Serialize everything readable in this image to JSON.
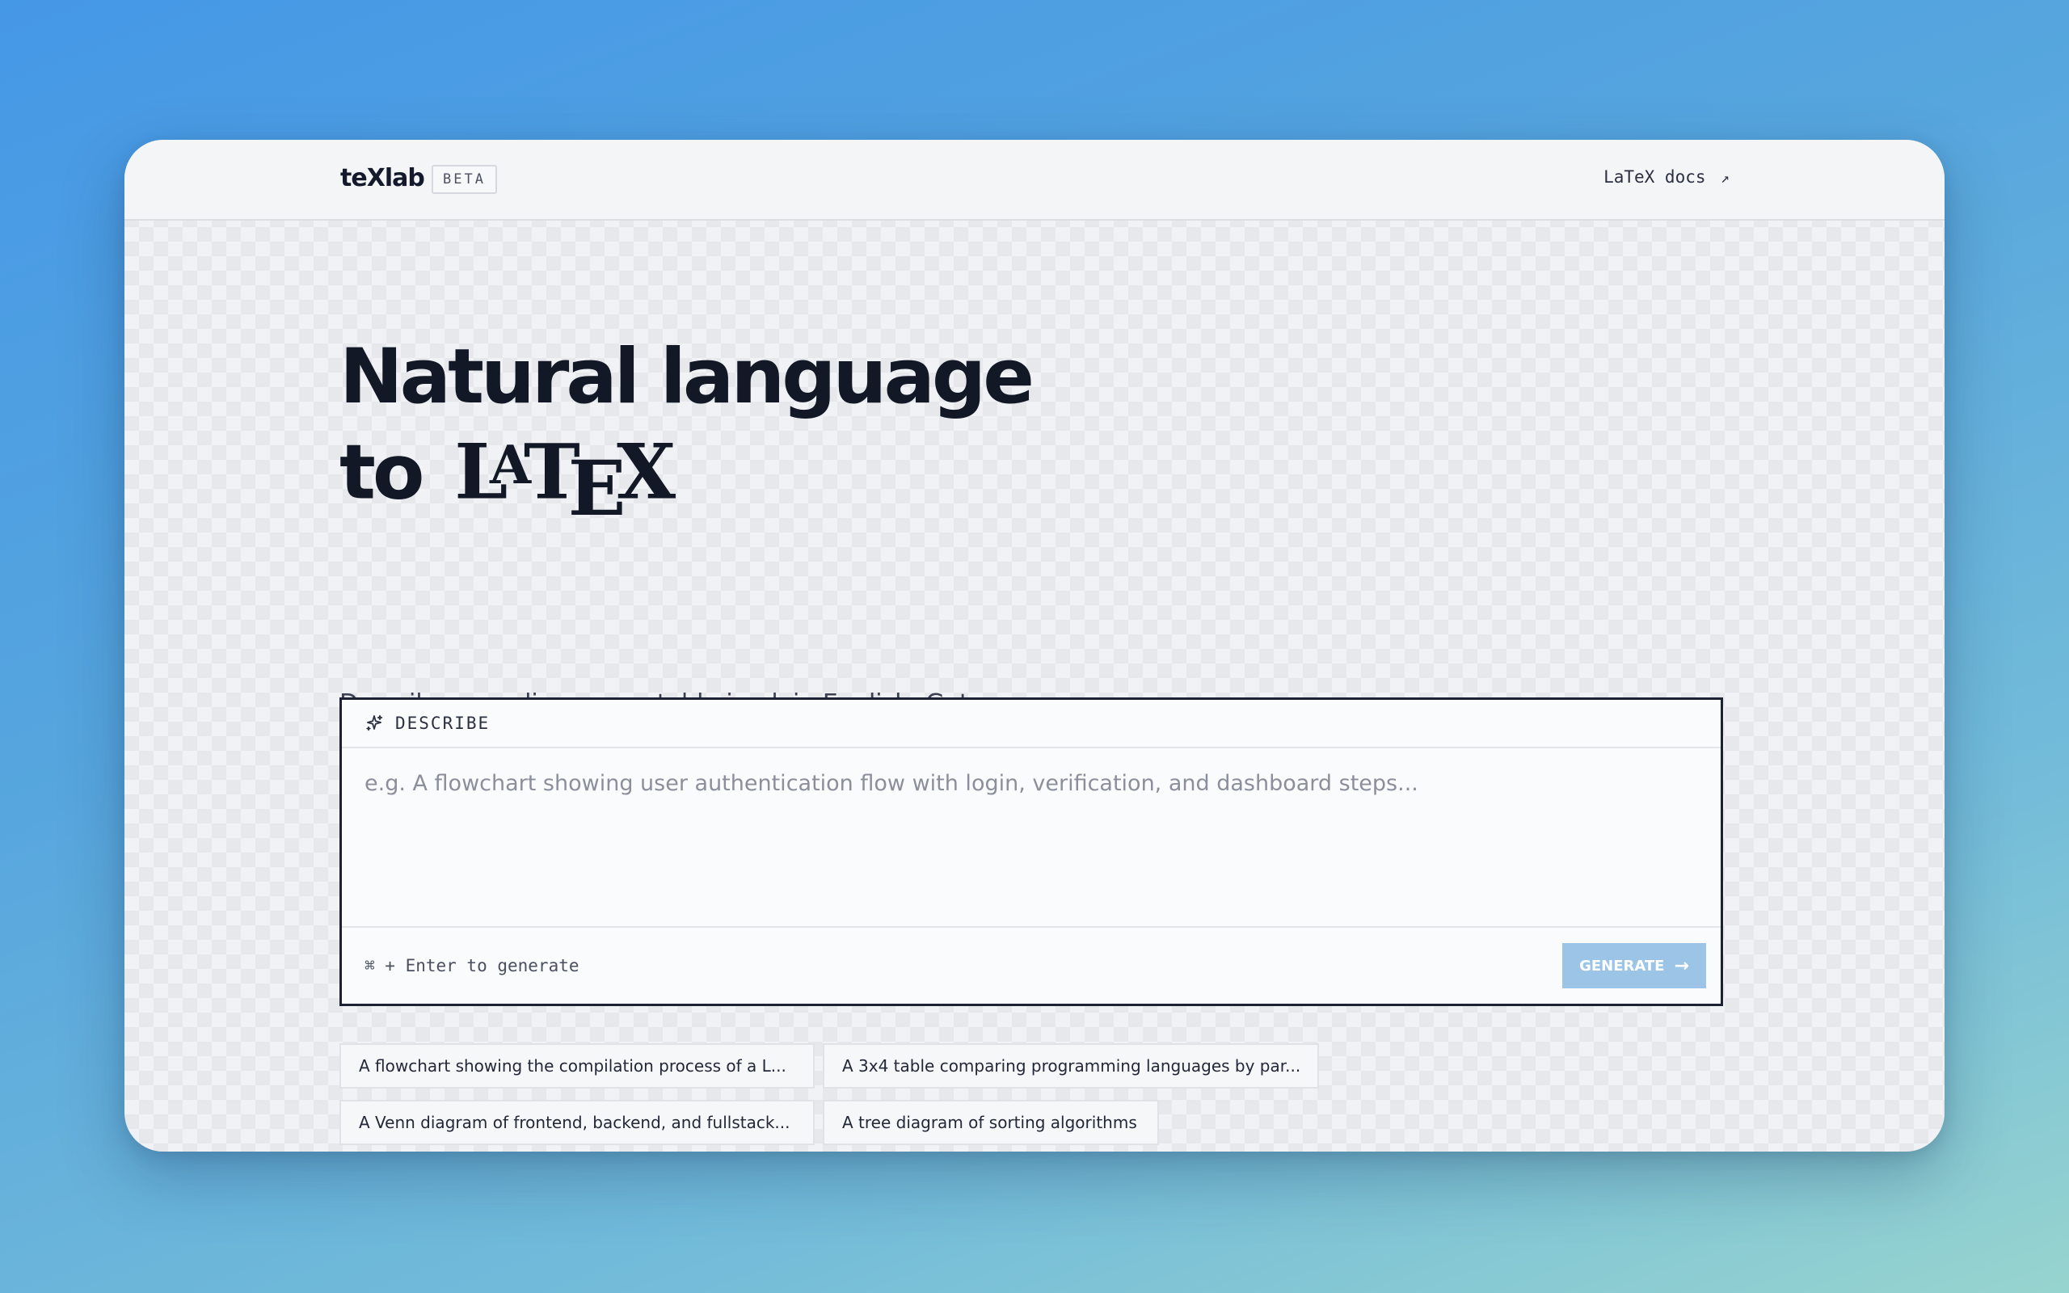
{
  "header": {
    "logo": "teXlab",
    "badge": "BETA",
    "docs_link": "LaTeX docs",
    "docs_arrow": "↗"
  },
  "hero": {
    "title_line1": "Natural language",
    "title_line2_prefix": "to",
    "latex_logo": "LaTeX",
    "subtitle": "Describe your diagram or table in plain English. Get production-ready LaTeX code instantly."
  },
  "input_card": {
    "label": "DESCRIBE",
    "icon": "sparkle-icon",
    "placeholder": "e.g. A flowchart showing user authentication flow with login, verification, and dashboard steps...",
    "value": "",
    "shortcut": "⌘ + Enter to generate",
    "generate_label": "GENERATE",
    "generate_icon": "arrow-right-icon"
  },
  "suggestions": [
    "A flowchart showing the compilation process of a L...",
    "A 3x4 table comparing programming languages by par...",
    "A Venn diagram of frontend, backend, and fullstack...",
    "A tree diagram of sorting algorithms"
  ],
  "colors": {
    "accent": "#9bc4e6",
    "text_dark": "#121826",
    "card_border": "#1c2233"
  }
}
